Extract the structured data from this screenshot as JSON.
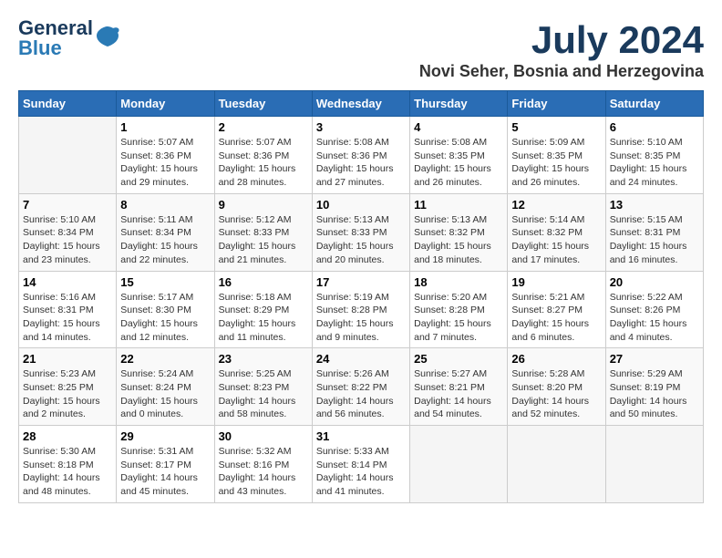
{
  "header": {
    "logo_general": "General",
    "logo_blue": "Blue",
    "title": "July 2024",
    "subtitle": "Novi Seher, Bosnia and Herzegovina"
  },
  "calendar": {
    "days_of_week": [
      "Sunday",
      "Monday",
      "Tuesday",
      "Wednesday",
      "Thursday",
      "Friday",
      "Saturday"
    ],
    "weeks": [
      [
        {
          "day": "",
          "info": ""
        },
        {
          "day": "1",
          "info": "Sunrise: 5:07 AM\nSunset: 8:36 PM\nDaylight: 15 hours\nand 29 minutes."
        },
        {
          "day": "2",
          "info": "Sunrise: 5:07 AM\nSunset: 8:36 PM\nDaylight: 15 hours\nand 28 minutes."
        },
        {
          "day": "3",
          "info": "Sunrise: 5:08 AM\nSunset: 8:36 PM\nDaylight: 15 hours\nand 27 minutes."
        },
        {
          "day": "4",
          "info": "Sunrise: 5:08 AM\nSunset: 8:35 PM\nDaylight: 15 hours\nand 26 minutes."
        },
        {
          "day": "5",
          "info": "Sunrise: 5:09 AM\nSunset: 8:35 PM\nDaylight: 15 hours\nand 26 minutes."
        },
        {
          "day": "6",
          "info": "Sunrise: 5:10 AM\nSunset: 8:35 PM\nDaylight: 15 hours\nand 24 minutes."
        }
      ],
      [
        {
          "day": "7",
          "info": "Sunrise: 5:10 AM\nSunset: 8:34 PM\nDaylight: 15 hours\nand 23 minutes."
        },
        {
          "day": "8",
          "info": "Sunrise: 5:11 AM\nSunset: 8:34 PM\nDaylight: 15 hours\nand 22 minutes."
        },
        {
          "day": "9",
          "info": "Sunrise: 5:12 AM\nSunset: 8:33 PM\nDaylight: 15 hours\nand 21 minutes."
        },
        {
          "day": "10",
          "info": "Sunrise: 5:13 AM\nSunset: 8:33 PM\nDaylight: 15 hours\nand 20 minutes."
        },
        {
          "day": "11",
          "info": "Sunrise: 5:13 AM\nSunset: 8:32 PM\nDaylight: 15 hours\nand 18 minutes."
        },
        {
          "day": "12",
          "info": "Sunrise: 5:14 AM\nSunset: 8:32 PM\nDaylight: 15 hours\nand 17 minutes."
        },
        {
          "day": "13",
          "info": "Sunrise: 5:15 AM\nSunset: 8:31 PM\nDaylight: 15 hours\nand 16 minutes."
        }
      ],
      [
        {
          "day": "14",
          "info": "Sunrise: 5:16 AM\nSunset: 8:31 PM\nDaylight: 15 hours\nand 14 minutes."
        },
        {
          "day": "15",
          "info": "Sunrise: 5:17 AM\nSunset: 8:30 PM\nDaylight: 15 hours\nand 12 minutes."
        },
        {
          "day": "16",
          "info": "Sunrise: 5:18 AM\nSunset: 8:29 PM\nDaylight: 15 hours\nand 11 minutes."
        },
        {
          "day": "17",
          "info": "Sunrise: 5:19 AM\nSunset: 8:28 PM\nDaylight: 15 hours\nand 9 minutes."
        },
        {
          "day": "18",
          "info": "Sunrise: 5:20 AM\nSunset: 8:28 PM\nDaylight: 15 hours\nand 7 minutes."
        },
        {
          "day": "19",
          "info": "Sunrise: 5:21 AM\nSunset: 8:27 PM\nDaylight: 15 hours\nand 6 minutes."
        },
        {
          "day": "20",
          "info": "Sunrise: 5:22 AM\nSunset: 8:26 PM\nDaylight: 15 hours\nand 4 minutes."
        }
      ],
      [
        {
          "day": "21",
          "info": "Sunrise: 5:23 AM\nSunset: 8:25 PM\nDaylight: 15 hours\nand 2 minutes."
        },
        {
          "day": "22",
          "info": "Sunrise: 5:24 AM\nSunset: 8:24 PM\nDaylight: 15 hours\nand 0 minutes."
        },
        {
          "day": "23",
          "info": "Sunrise: 5:25 AM\nSunset: 8:23 PM\nDaylight: 14 hours\nand 58 minutes."
        },
        {
          "day": "24",
          "info": "Sunrise: 5:26 AM\nSunset: 8:22 PM\nDaylight: 14 hours\nand 56 minutes."
        },
        {
          "day": "25",
          "info": "Sunrise: 5:27 AM\nSunset: 8:21 PM\nDaylight: 14 hours\nand 54 minutes."
        },
        {
          "day": "26",
          "info": "Sunrise: 5:28 AM\nSunset: 8:20 PM\nDaylight: 14 hours\nand 52 minutes."
        },
        {
          "day": "27",
          "info": "Sunrise: 5:29 AM\nSunset: 8:19 PM\nDaylight: 14 hours\nand 50 minutes."
        }
      ],
      [
        {
          "day": "28",
          "info": "Sunrise: 5:30 AM\nSunset: 8:18 PM\nDaylight: 14 hours\nand 48 minutes."
        },
        {
          "day": "29",
          "info": "Sunrise: 5:31 AM\nSunset: 8:17 PM\nDaylight: 14 hours\nand 45 minutes."
        },
        {
          "day": "30",
          "info": "Sunrise: 5:32 AM\nSunset: 8:16 PM\nDaylight: 14 hours\nand 43 minutes."
        },
        {
          "day": "31",
          "info": "Sunrise: 5:33 AM\nSunset: 8:14 PM\nDaylight: 14 hours\nand 41 minutes."
        },
        {
          "day": "",
          "info": ""
        },
        {
          "day": "",
          "info": ""
        },
        {
          "day": "",
          "info": ""
        }
      ]
    ]
  }
}
